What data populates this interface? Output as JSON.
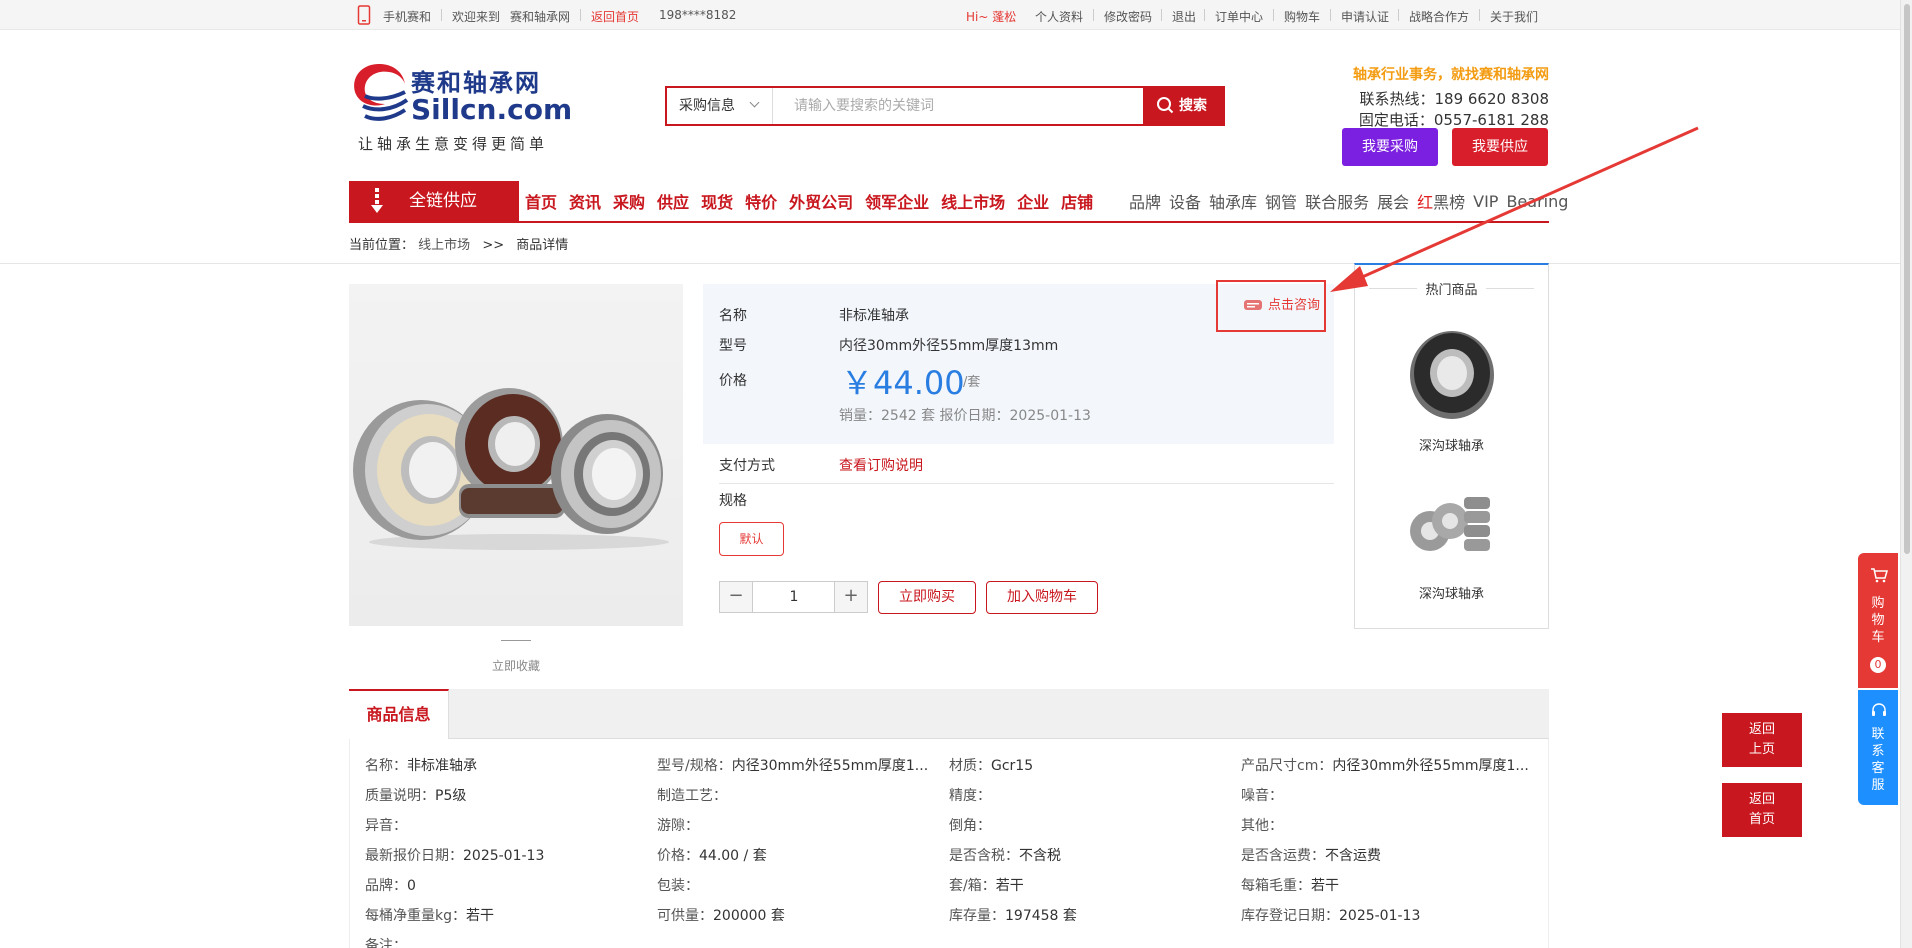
{
  "topbar": {
    "mobile": "手机赛和",
    "welcome": "欢迎来到",
    "site_name": "赛和轴承网",
    "back_home": "返回首页",
    "phone": "198****8182",
    "greeting": "Hi~ 蓬松",
    "links": [
      "个人资料",
      "修改密码",
      "退出",
      "订单中心",
      "购物车",
      "申请认证",
      "战略合作方",
      "关于我们"
    ]
  },
  "logo": {
    "cn": "赛和轴承网",
    "en": "Sillcn.com",
    "slogan": "让轴承生意变得更简单"
  },
  "search": {
    "category": "采购信息",
    "placeholder": "请输入要搜索的关键词",
    "button": "搜索"
  },
  "hotline": {
    "slogan": "轴承行业事务，就找赛和轴承网",
    "tel_label": "联系热线：189 6620 8308",
    "fixed_label": "固定电话：0557-6181 288"
  },
  "cta": {
    "purchase": "我要采购",
    "supply": "我要供应"
  },
  "nav": {
    "chain": "全链供应",
    "main": [
      "首页",
      "资讯",
      "采购",
      "供应",
      "现货",
      "特价",
      "外贸公司",
      "领军企业",
      "线上市场",
      "企业",
      "店铺"
    ],
    "secondary": [
      "品牌",
      "设备",
      "轴承库",
      "钢管",
      "联合服务",
      "展会"
    ],
    "red": "红",
    "black": "黑榜",
    "vip": "VIP",
    "bearing": "Bearing"
  },
  "breadcrumb": {
    "label": "当前位置：",
    "market": "线上市场",
    "sep": ">>",
    "current": "商品详情"
  },
  "product": {
    "name_label": "名称",
    "name": "非标准轴承",
    "model_label": "型号",
    "model": "内径30mm外径55mm厚度13mm",
    "price_label": "价格",
    "price": "￥44.00",
    "unit": "/套",
    "sales": "销量：2542 套    报价日期：2025-01-13",
    "consult": "点击咨询",
    "pay_label": "支付方式",
    "pay_link": "查看订购说明",
    "spec_label": "规格",
    "spec_default": "默认",
    "qty": "1",
    "minus": "−",
    "plus": "+",
    "buy_now": "立即购买",
    "add_cart": "加入购物车",
    "collect": "立即收藏"
  },
  "hot": {
    "title": "热门商品",
    "items": [
      {
        "name": "深沟球轴承"
      },
      {
        "name": "深沟球轴承"
      }
    ]
  },
  "detail": {
    "tab": "商品信息",
    "rows": [
      [
        [
          "名称：",
          "非标准轴承"
        ],
        [
          "型号/规格：",
          "内径30mm外径55mm厚度1..."
        ],
        [
          "材质：",
          "Gcr15"
        ],
        [
          "产品尺寸cm：",
          "内径30mm外径55mm厚度1..."
        ]
      ],
      [
        [
          "质量说明：",
          "P5级"
        ],
        [
          "制造工艺：",
          ""
        ],
        [
          "精度：",
          ""
        ],
        [
          "噪音：",
          ""
        ]
      ],
      [
        [
          "异音：",
          ""
        ],
        [
          "游隙：",
          ""
        ],
        [
          "倒角：",
          ""
        ],
        [
          "其他：",
          ""
        ]
      ],
      [
        [
          "最新报价日期：",
          "2025-01-13"
        ],
        [
          "价格：",
          "44.00 / 套"
        ],
        [
          "是否含税：",
          "不含税"
        ],
        [
          "是否含运费：",
          "不含运费"
        ]
      ],
      [
        [
          "品牌：",
          "0"
        ],
        [
          "包装：",
          ""
        ],
        [
          "套/箱：",
          "若干"
        ],
        [
          "每箱毛重：",
          "若干"
        ]
      ],
      [
        [
          "每桶净重量kg：",
          "若干"
        ],
        [
          "可供量：",
          "200000 套"
        ],
        [
          "库存量：",
          "197458 套"
        ],
        [
          "库存登记日期：",
          "2025-01-13"
        ]
      ],
      [
        [
          "备注：",
          ""
        ]
      ]
    ]
  },
  "side": {
    "cart": [
      "购",
      "物",
      "车"
    ],
    "cart_count": "0",
    "service": [
      "联",
      "系",
      "客",
      "服"
    ],
    "back_prev": [
      "返回",
      "上页"
    ],
    "back_home": [
      "返回",
      "首页"
    ]
  },
  "colors": {
    "brand_red": "#c8171e",
    "price_blue": "#2a7de1",
    "purple": "#7b1fe0",
    "annotation": "#e53935"
  }
}
